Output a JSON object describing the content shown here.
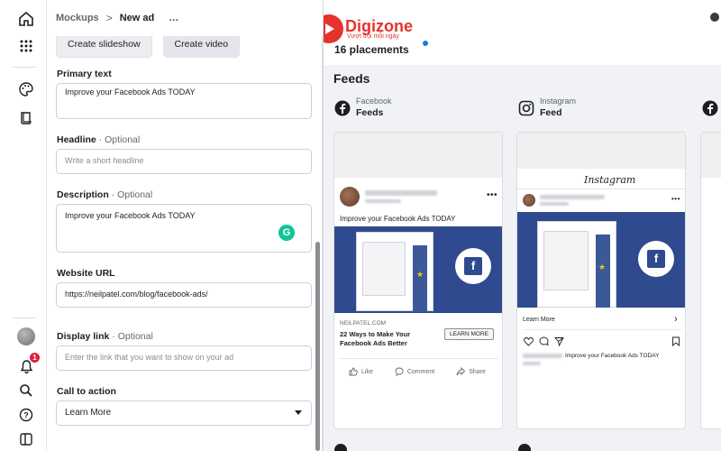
{
  "breadcrumb": {
    "parent": "Mockups",
    "separator": ">",
    "current": "New ad",
    "more": "…"
  },
  "editor": {
    "buttons": {
      "slideshow": "Create slideshow",
      "video": "Create video"
    },
    "primary_text": {
      "label": "Primary text",
      "value": "Improve your Facebook Ads TODAY"
    },
    "headline": {
      "label": "Headline",
      "optional": "· Optional",
      "placeholder": "Write a short headline"
    },
    "description": {
      "label": "Description",
      "optional": "· Optional",
      "value": "Improve your Facebook Ads TODAY"
    },
    "website_url": {
      "label": "Website URL",
      "value": "https://neilpatel.com/blog/facebook-ads/"
    },
    "display_link": {
      "label": "Display link",
      "optional": "· Optional",
      "placeholder": "Enter the link that you want to show on your ad"
    },
    "cta": {
      "label": "Call to action",
      "value": "Learn More"
    }
  },
  "rail": {
    "notification_count": "1"
  },
  "preview": {
    "logo": {
      "name": "Digizone",
      "tagline": "Vượt trội mỗi ngày"
    },
    "placements": "16 placements",
    "section_title": "Feeds",
    "facebook": {
      "platform": "Facebook",
      "placement": "Feeds",
      "post_text": "Improve your Facebook Ads TODAY",
      "domain": "NEILPATEL.COM",
      "headline": "22 Ways to Make Your Facebook Ads Better",
      "cta": "LEARN MORE",
      "like": "Like",
      "comment": "Comment",
      "share": "Share"
    },
    "instagram": {
      "platform": "Instagram",
      "placement": "Feed",
      "logo_text": "Instagram",
      "cta": "Learn More",
      "caption": "Improve your Facebook Ads TODAY"
    },
    "colors": {
      "accent_blue": "#1877f2",
      "brand_red": "#e5322d",
      "creative_blue": "#2f4a8e",
      "star": "#f5c518"
    }
  }
}
